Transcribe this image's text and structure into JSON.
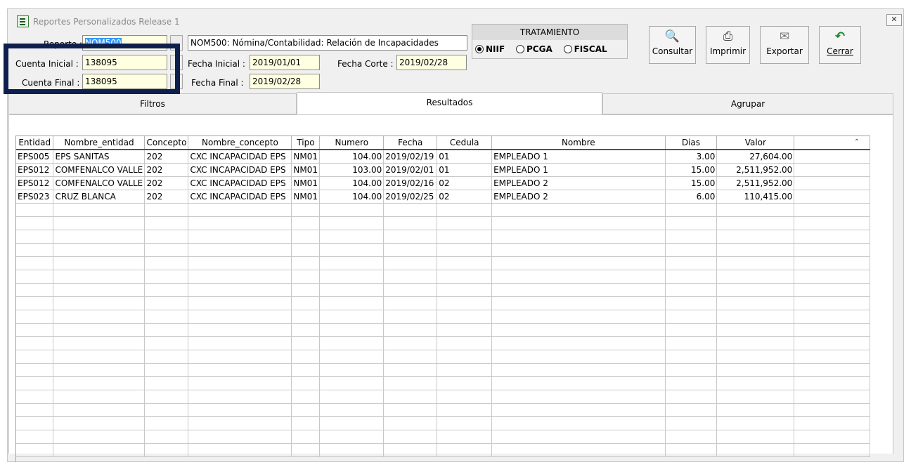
{
  "window": {
    "title": "Reportes Personalizados Release 1",
    "close_glyph": "✕"
  },
  "form": {
    "reporte_label": "Reporte :",
    "reporte_value": "NOM500",
    "reporte_desc": "NOM500: Nómina/Contabilidad: Relación de Incapacidades",
    "cuenta_inicial_label": "Cuenta Inicial :",
    "cuenta_inicial_value": "138095",
    "cuenta_final_label": "Cuenta Final :",
    "cuenta_final_value": "138095",
    "fecha_inicial_label": "Fecha Inicial :",
    "fecha_inicial_value": "2019/01/01",
    "fecha_final_label": "Fecha Final :",
    "fecha_final_value": "2019/02/28",
    "fecha_corte_label": "Fecha Corte :",
    "fecha_corte_value": "2019/02/28"
  },
  "tratamiento": {
    "title": "TRATAMIENTO",
    "options": [
      "NIIF",
      "PCGA",
      "FISCAL"
    ],
    "selected": "NIIF"
  },
  "toolbar": {
    "consultar": "Consultar",
    "imprimir": "Imprimir",
    "exportar": "Exportar",
    "cerrar": "Cerrar"
  },
  "tabs": [
    "Filtros",
    "Resultados",
    "Agrupar"
  ],
  "active_tab": "Resultados",
  "grid": {
    "columns": [
      "Entidad",
      "Nombre_entidad",
      "Concepto",
      "Nombre_concepto",
      "Tipo",
      "Numero",
      "Fecha",
      "Cedula",
      "Nombre",
      "Dias",
      "Valor"
    ],
    "rows": [
      [
        "EPS005",
        "EPS SANITAS",
        "202",
        "CXC INCAPACIDAD EPS",
        "NM01",
        "104.00",
        "2019/02/19",
        "01",
        "EMPLEADO 1",
        "3.00",
        "27,604.00"
      ],
      [
        "EPS012",
        "COMFENALCO VALLE",
        "202",
        "CXC INCAPACIDAD EPS",
        "NM01",
        "103.00",
        "2019/02/01",
        "01",
        "EMPLEADO 1",
        "15.00",
        "2,511,952.00"
      ],
      [
        "EPS012",
        "COMFENALCO VALLE",
        "202",
        "CXC INCAPACIDAD EPS",
        "NM01",
        "104.00",
        "2019/02/16",
        "02",
        "EMPLEADO 2",
        "15.00",
        "2,511,952.00"
      ],
      [
        "EPS023",
        "CRUZ BLANCA",
        "202",
        "CXC INCAPACIDAD EPS",
        "NM01",
        "104.00",
        "2019/02/25",
        "02",
        "EMPLEADO 2",
        "6.00",
        "110,415.00"
      ]
    ]
  },
  "colors": {
    "field_bg": "#ffffe1",
    "selection": "#3399ff",
    "highlight_border": "#0e1f4d"
  }
}
